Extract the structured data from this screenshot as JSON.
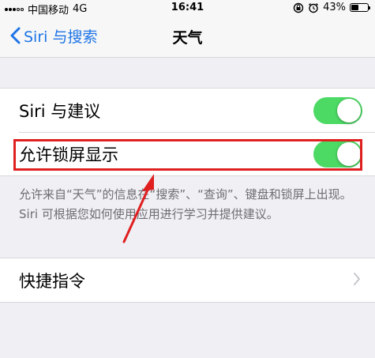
{
  "status_bar": {
    "carrier": "中国移动",
    "network": "4G",
    "time": "16:41",
    "battery": "43%",
    "battery_level": 0.43
  },
  "nav": {
    "back_label": "Siri 与搜索",
    "title": "天气"
  },
  "settings": {
    "siri_suggestions": {
      "label": "Siri 与建议",
      "on": true
    },
    "lock_screen": {
      "label": "允许锁屏显示",
      "on": true
    },
    "footer": "允许来自“天气”的信息在“搜索”、“查询”、键盘和锁屏上出现。Siri 可根据您如何使用应用进行学习并提供建议。"
  },
  "shortcuts": {
    "label": "快捷指令"
  },
  "colors": {
    "accent": "#1d74e7",
    "toggle_on": "#4cd964",
    "highlight": "#e01f1f"
  }
}
